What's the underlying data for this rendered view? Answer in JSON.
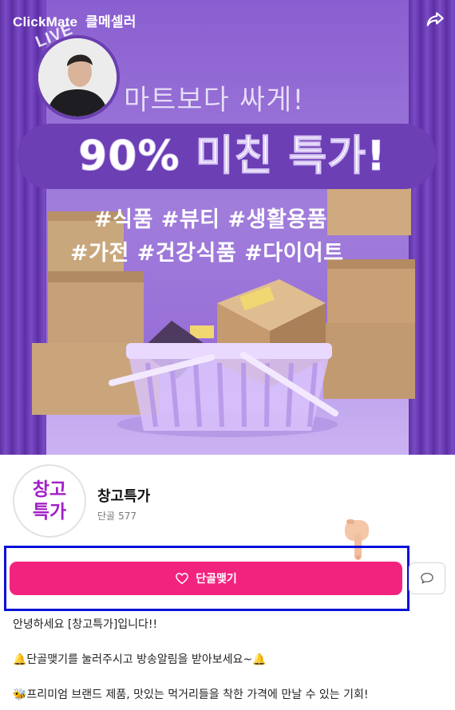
{
  "topbar": {
    "brand": "ClickMate",
    "brand_kr": "클메셀러"
  },
  "banner": {
    "live_label": "LIVE",
    "headline1": "마트보다 싸게!",
    "headline2": "90% 미친 특가!",
    "tags_line1": "#식품 #뷰티 #생활용품",
    "tags_line2": "#가전 #건강식품 #다이어트",
    "colors": {
      "background": "#9a72d8",
      "band": "#6c3fb5",
      "curtain": "#6a3ab6"
    }
  },
  "shop": {
    "logo_text": "창고특가",
    "name": "창고특가",
    "subscribers_label": "단골",
    "subscribers_count": "577"
  },
  "actions": {
    "subscribe_label": "단골맺기",
    "accent_color": "#f2237f",
    "highlight_color": "#0a11d8"
  },
  "description": {
    "line1": "안녕하세요 [창고특가]입니다!!",
    "line2": "🔔단골맺기를 눌러주시고 방송알림을 받아보세요~🔔",
    "line3": "🐝프리미엄 브랜드 제품, 맛있는 먹거리들을 착한 가격에 만날 수 있는 기회!"
  },
  "icons": [
    "share-icon",
    "heart-icon",
    "chat-bubble-icon",
    "pointing-hand-icon"
  ]
}
